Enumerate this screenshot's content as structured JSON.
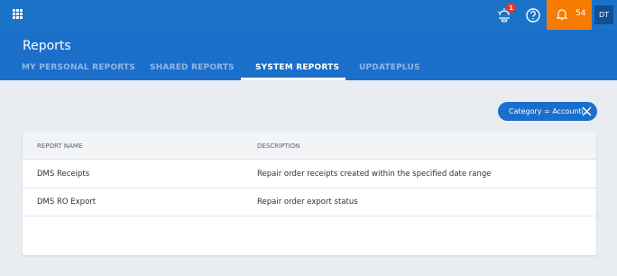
{
  "topbar": {
    "badge_count": "1",
    "notification_count": "54",
    "user_initials": "DT"
  },
  "header": {
    "title": "Reports",
    "tabs": [
      {
        "label": "MY PERSONAL REPORTS",
        "active": false
      },
      {
        "label": "SHARED REPORTS",
        "active": false
      },
      {
        "label": "SYSTEM REPORTS",
        "active": true
      },
      {
        "label": "UPDATEPLUS",
        "active": false
      }
    ]
  },
  "filter_chip": {
    "label": "Category = Accounti..."
  },
  "table": {
    "columns": [
      "REPORT NAME",
      "DESCRIPTION"
    ],
    "rows": [
      {
        "name": "DMS Receipts",
        "description": "Repair order receipts created within the specified date range"
      },
      {
        "name": "DMS RO Export",
        "description": "Repair order export status"
      }
    ]
  },
  "colors": {
    "topbar": "#1a73c9",
    "header": "#1b6fcb",
    "notification_bg": "#f57c00",
    "badge": "#e0362c",
    "avatar_bg": "#104f93",
    "page_bg": "#e9edf1"
  }
}
